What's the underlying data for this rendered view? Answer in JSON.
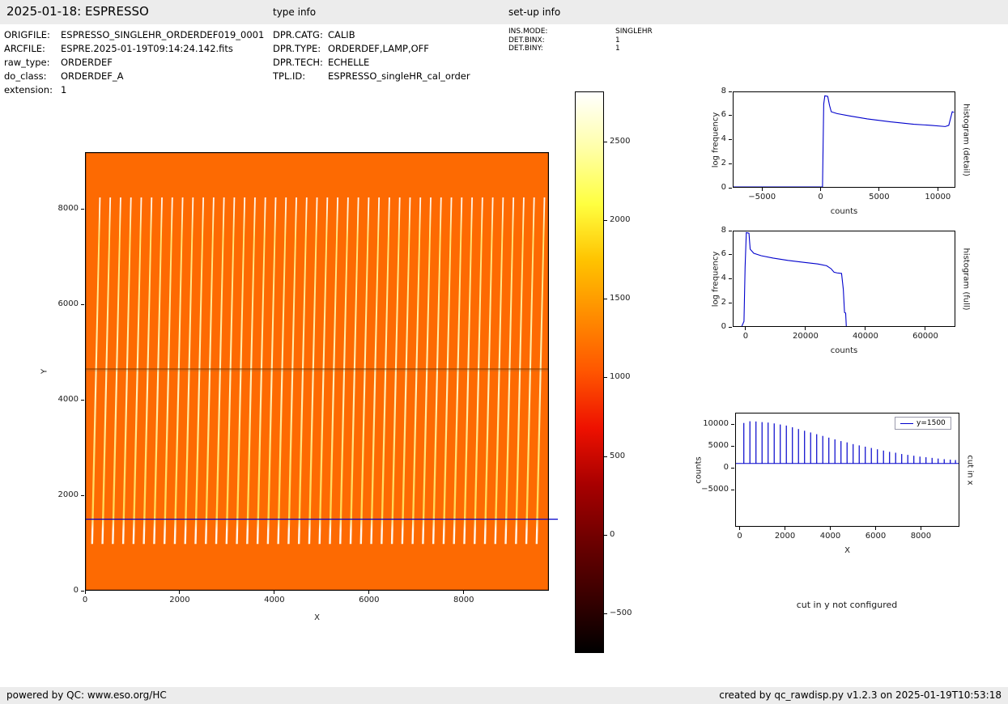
{
  "header": {
    "title": "2025-01-18: ESPRESSO",
    "type_info_label": "type info",
    "setup_info_label": "set-up info"
  },
  "file_info": [
    {
      "label": "ORIGFILE:",
      "value": "ESPRESSO_SINGLEHR_ORDERDEF019_0001"
    },
    {
      "label": "ARCFILE:",
      "value": "ESPRE.2025-01-19T09:14:24.142.fits"
    },
    {
      "label": "raw_type:",
      "value": "ORDERDEF"
    },
    {
      "label": "do_class:",
      "value": "ORDERDEF_A"
    },
    {
      "label": "extension:",
      "value": "1"
    }
  ],
  "type_info": [
    {
      "label": "DPR.CATG:",
      "value": "CALIB"
    },
    {
      "label": "DPR.TYPE:",
      "value": "ORDERDEF,LAMP,OFF"
    },
    {
      "label": "DPR.TECH:",
      "value": "ECHELLE"
    },
    {
      "label": "TPL.ID:",
      "value": "ESPRESSO_singleHR_cal_order"
    }
  ],
  "setup_info": [
    {
      "label": "INS.MODE:",
      "value": "SINGLEHR"
    },
    {
      "label": "DET.BINX:",
      "value": "1"
    },
    {
      "label": "DET.BINY:",
      "value": "1"
    }
  ],
  "footer": {
    "left": "powered by QC: www.eso.org/HC",
    "right": "created by qc_rawdisp.py v1.2.3 on 2025-01-19T10:53:18"
  },
  "cut_in_y_note": "cut in y not configured",
  "colors": {
    "bar_bg": "#ececec",
    "line_blue": "#0000cc",
    "heatmap_bg": "#fd6a02",
    "hot_colormap_top_to_bottom": [
      "#ffffff",
      "#ffffa8",
      "#ffff40",
      "#ffc300",
      "#ff8c00",
      "#ff5500",
      "#ee1100",
      "#a80000",
      "#6e0000",
      "#3a0000",
      "#000000"
    ]
  },
  "chart_data": [
    {
      "id": "raw_image",
      "type": "heatmap",
      "xlabel": "X",
      "ylabel": "Y",
      "xlim": [
        0,
        9800
      ],
      "ylim": [
        0,
        9200
      ],
      "xticks": [
        0,
        2000,
        4000,
        6000,
        8000
      ],
      "yticks": [
        0,
        2000,
        4000,
        6000,
        8000
      ],
      "stripes": {
        "count": 44,
        "x_first": 130,
        "x_last": 9520,
        "y_bottom": 980,
        "y_top": 8250,
        "top_shift": 170
      },
      "gap_line_y": 4650,
      "cut_line_y": 1500,
      "colorbar": {
        "vmin": -750,
        "vmax": 2820,
        "ticks": [
          2500,
          2000,
          1500,
          1000,
          500,
          0,
          -500
        ]
      }
    },
    {
      "id": "histogram_detail",
      "type": "line",
      "right_label": "histogram (detail)",
      "xlabel": "counts",
      "ylabel": "log frequency",
      "xlim": [
        -7500,
        11500
      ],
      "ylim": [
        0,
        8
      ],
      "xticks": [
        -5000,
        0,
        5000,
        10000
      ],
      "yticks": [
        0,
        2,
        4,
        6,
        8
      ],
      "points": [
        [
          -7500,
          0
        ],
        [
          150,
          0
        ],
        [
          250,
          7.0
        ],
        [
          350,
          7.7
        ],
        [
          600,
          7.65
        ],
        [
          750,
          6.9
        ],
        [
          900,
          6.35
        ],
        [
          1400,
          6.2
        ],
        [
          2500,
          6.0
        ],
        [
          4000,
          5.75
        ],
        [
          6000,
          5.5
        ],
        [
          8000,
          5.3
        ],
        [
          9500,
          5.2
        ],
        [
          10700,
          5.1
        ],
        [
          11000,
          5.2
        ],
        [
          11300,
          6.35
        ],
        [
          11450,
          6.3
        ]
      ]
    },
    {
      "id": "histogram_full",
      "type": "line",
      "right_label": "histogram (full)",
      "xlabel": "counts",
      "ylabel": "log frequency",
      "xlim": [
        -4300,
        70000
      ],
      "ylim": [
        0,
        8
      ],
      "xticks": [
        0,
        20000,
        40000,
        60000
      ],
      "yticks": [
        0,
        2,
        4,
        6,
        8
      ],
      "points": [
        [
          -1500,
          0
        ],
        [
          -800,
          0.4
        ],
        [
          -400,
          5.0
        ],
        [
          0,
          7.9
        ],
        [
          900,
          7.85
        ],
        [
          1300,
          6.5
        ],
        [
          2500,
          6.15
        ],
        [
          5000,
          5.95
        ],
        [
          9000,
          5.75
        ],
        [
          14000,
          5.55
        ],
        [
          19000,
          5.4
        ],
        [
          24000,
          5.25
        ],
        [
          27000,
          5.1
        ],
        [
          28500,
          4.85
        ],
        [
          29500,
          4.55
        ],
        [
          30500,
          4.5
        ],
        [
          32000,
          4.45
        ],
        [
          32600,
          3.1
        ],
        [
          33000,
          1.15
        ],
        [
          33400,
          1.1
        ],
        [
          33600,
          0
        ]
      ]
    },
    {
      "id": "cut_in_x",
      "type": "spikes",
      "right_label": "cut in x",
      "legend": "y=1500",
      "xlabel": "X",
      "ylabel": "counts",
      "xlim": [
        -200,
        9700
      ],
      "ylim": [
        -13500,
        12600
      ],
      "xticks": [
        0,
        2000,
        4000,
        6000,
        8000
      ],
      "yticks": [
        10000,
        5000,
        0,
        -5000
      ],
      "baseline": 1000,
      "spikes": [
        [
          150,
          10400
        ],
        [
          420,
          10800
        ],
        [
          690,
          10750
        ],
        [
          960,
          10600
        ],
        [
          1230,
          10500
        ],
        [
          1500,
          10300
        ],
        [
          1770,
          10050
        ],
        [
          2040,
          9800
        ],
        [
          2310,
          9400
        ],
        [
          2580,
          9000
        ],
        [
          2850,
          8600
        ],
        [
          3120,
          8200
        ],
        [
          3390,
          7800
        ],
        [
          3660,
          7400
        ],
        [
          3930,
          7000
        ],
        [
          4200,
          6600
        ],
        [
          4470,
          6200
        ],
        [
          4740,
          5900
        ],
        [
          5010,
          5500
        ],
        [
          5280,
          5200
        ],
        [
          5550,
          4900
        ],
        [
          5820,
          4600
        ],
        [
          6090,
          4300
        ],
        [
          6360,
          4000
        ],
        [
          6630,
          3700
        ],
        [
          6900,
          3500
        ],
        [
          7170,
          3200
        ],
        [
          7440,
          3000
        ],
        [
          7710,
          2800
        ],
        [
          7980,
          2600
        ],
        [
          8250,
          2450
        ],
        [
          8520,
          2300
        ],
        [
          8790,
          2150
        ],
        [
          9060,
          2000
        ],
        [
          9330,
          1900
        ],
        [
          9560,
          1800
        ]
      ]
    }
  ]
}
